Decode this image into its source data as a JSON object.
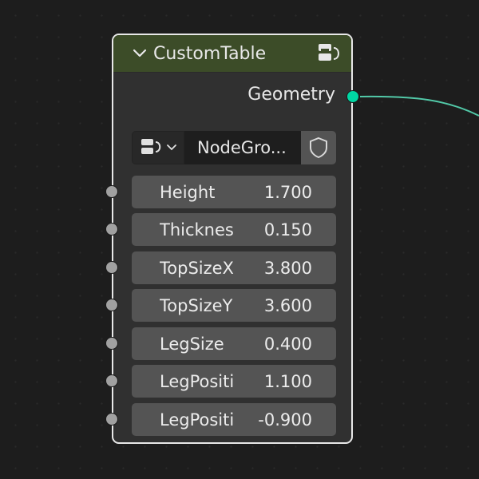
{
  "node": {
    "title": "CustomTable",
    "output_label": "Geometry",
    "group_name": "NodeGro...",
    "header_color": "#3c4c28",
    "inputs": [
      {
        "label": "Height",
        "value": "1.700"
      },
      {
        "label": "Thicknes",
        "value": "0.150"
      },
      {
        "label": "TopSizeX",
        "value": "3.800"
      },
      {
        "label": "TopSizeY",
        "value": "3.600"
      },
      {
        "label": "LegSize",
        "value": "0.400"
      },
      {
        "label": "LegPositi",
        "value": "1.100"
      },
      {
        "label": "LegPositi",
        "value": "-0.900"
      }
    ]
  },
  "colors": {
    "geometry_socket": "#00d6a3",
    "float_socket": "#a1a1a1",
    "link": "#52c9a8"
  },
  "icons": {
    "collapse": "chevron-down-icon",
    "header": "node-group-icon",
    "selector": "node-group-icon",
    "fake_user": "shield-icon"
  }
}
